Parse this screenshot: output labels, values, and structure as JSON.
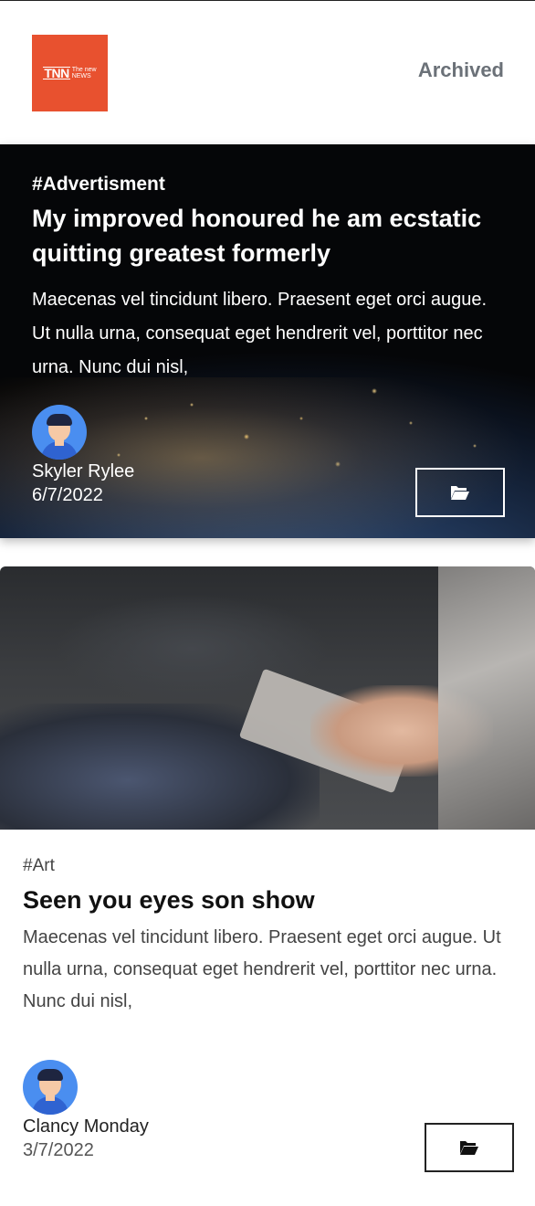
{
  "header": {
    "logo": {
      "main": "TNN",
      "line1": "The new",
      "line2": "NEWS"
    },
    "archived_label": "Archived"
  },
  "featured": {
    "tag": "#Advertisment",
    "title": "My improved honoured he am ecstatic quitting greatest formerly",
    "excerpt": "Maecenas vel tincidunt libero. Praesent eget orci augue. Ut nulla urna, consequat eget hendrerit vel, porttitor nec urna. Nunc dui nisl,",
    "author": "Skyler Rylee",
    "date": "6/7/2022",
    "action_icon": "folder-open-icon"
  },
  "articles": [
    {
      "tag": "#Art",
      "title": "Seen you eyes son show",
      "excerpt": "Maecenas vel tincidunt libero. Praesent eget orci augue. Ut nulla urna, consequat eget hendrerit vel, porttitor nec urna. Nunc dui nisl,",
      "author": "Clancy Monday",
      "date": "3/7/2022",
      "action_icon": "folder-open-icon"
    }
  ],
  "colors": {
    "logo_bg": "#e8512f",
    "nav_text": "#6b7178",
    "avatar_bg": "#4a8ef0"
  }
}
